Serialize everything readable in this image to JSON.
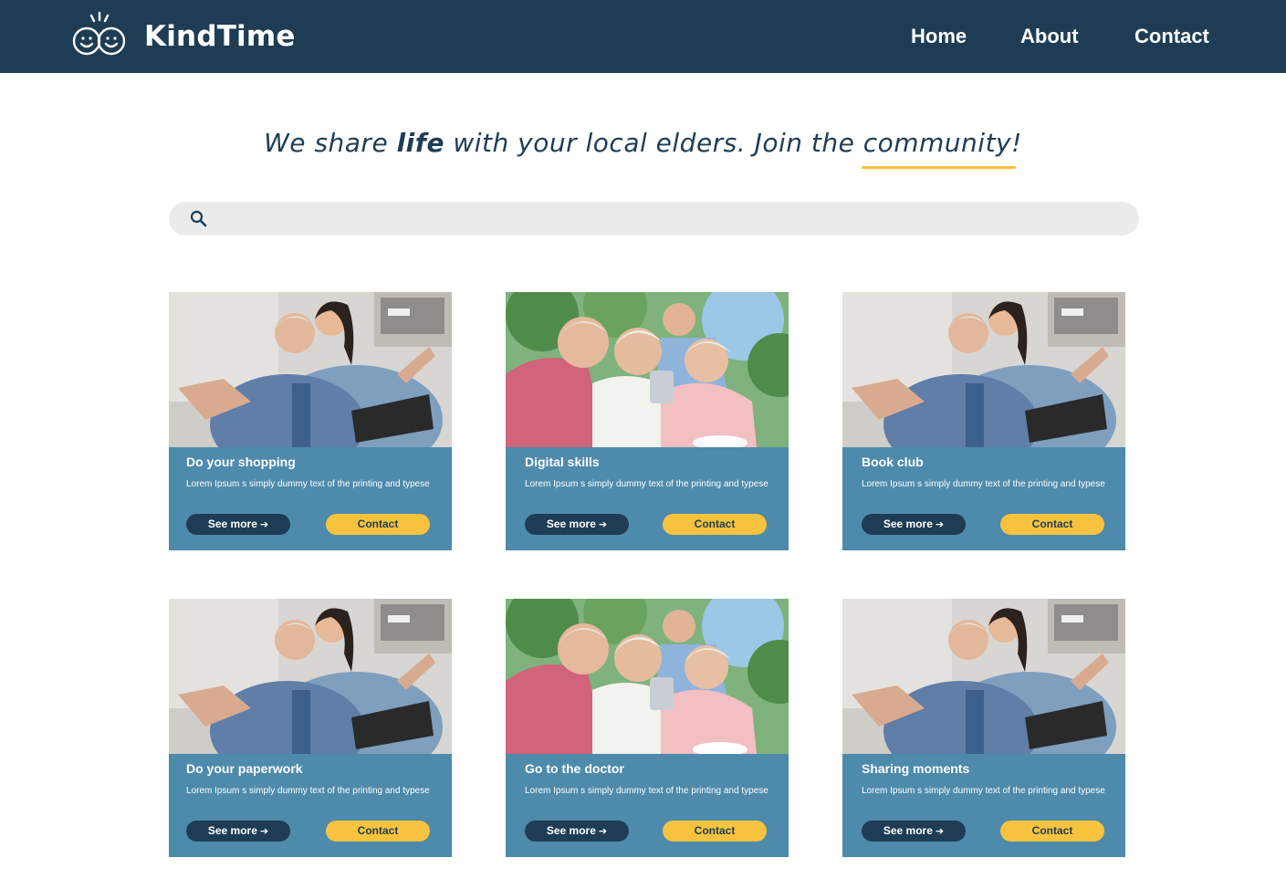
{
  "header": {
    "brand": "KindTime",
    "nav": [
      "Home",
      "About",
      "Contact"
    ]
  },
  "hero": {
    "tagline_before": "We share ",
    "tagline_bold": "life",
    "tagline_after": " with your local elders. Join the community!",
    "accent_color": "#f7c33e"
  },
  "search": {
    "placeholder": "",
    "value": "",
    "icon": "search-icon"
  },
  "colors": {
    "navy": "#1e3d54",
    "card_blue": "#4e8aab",
    "yellow": "#f7c33e",
    "search_bg": "#ebebeb"
  },
  "cards": [
    {
      "title": "Do your shopping",
      "desc": "Lorem Ipsum s simply dummy text of the printing and typese",
      "see_more": "See more",
      "contact": "Contact",
      "photo": "elder-man-with-young-woman"
    },
    {
      "title": "Digital skills",
      "desc": "Lorem Ipsum s simply dummy text of the printing and typese",
      "see_more": "See more",
      "contact": "Contact",
      "photo": "elder-women-with-smartphone"
    },
    {
      "title": "Book club",
      "desc": "Lorem Ipsum s simply dummy text of the printing and typese",
      "see_more": "See more",
      "contact": "Contact",
      "photo": "elder-man-with-young-woman"
    },
    {
      "title": "Do your paperwork",
      "desc": "Lorem Ipsum s simply dummy text of the printing and typese",
      "see_more": "See more",
      "contact": "Contact",
      "photo": "elder-man-with-young-woman"
    },
    {
      "title": "Go to the doctor",
      "desc": "Lorem Ipsum s simply dummy text of the printing and typese",
      "see_more": "See more",
      "contact": "Contact",
      "photo": "elder-women-with-smartphone"
    },
    {
      "title": "Sharing moments",
      "desc": "Lorem Ipsum s simply dummy text of the printing and typese",
      "see_more": "See more",
      "contact": "Contact",
      "photo": "elder-man-with-young-woman"
    }
  ]
}
